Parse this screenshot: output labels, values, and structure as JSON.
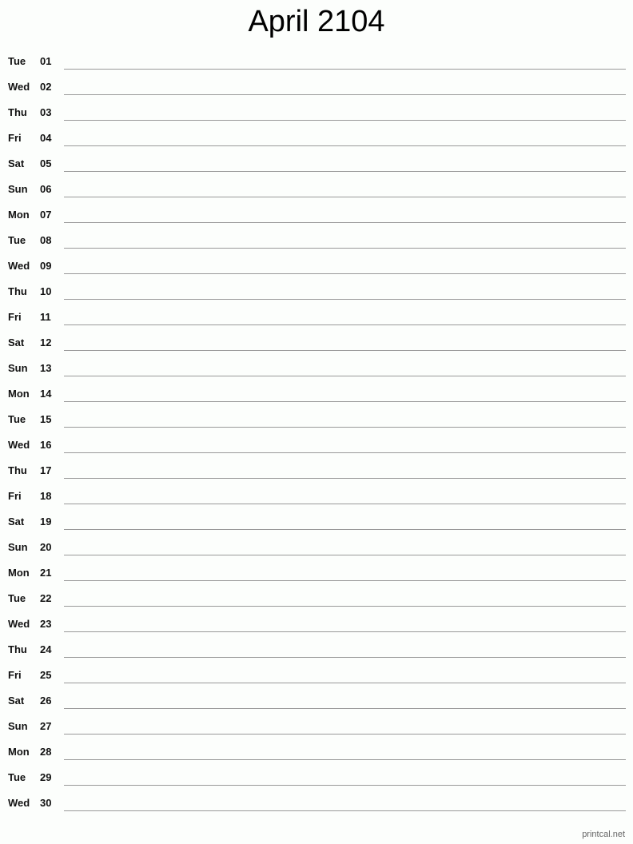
{
  "title": "April 2104",
  "days": [
    {
      "dow": "Tue",
      "day": "01"
    },
    {
      "dow": "Wed",
      "day": "02"
    },
    {
      "dow": "Thu",
      "day": "03"
    },
    {
      "dow": "Fri",
      "day": "04"
    },
    {
      "dow": "Sat",
      "day": "05"
    },
    {
      "dow": "Sun",
      "day": "06"
    },
    {
      "dow": "Mon",
      "day": "07"
    },
    {
      "dow": "Tue",
      "day": "08"
    },
    {
      "dow": "Wed",
      "day": "09"
    },
    {
      "dow": "Thu",
      "day": "10"
    },
    {
      "dow": "Fri",
      "day": "11"
    },
    {
      "dow": "Sat",
      "day": "12"
    },
    {
      "dow": "Sun",
      "day": "13"
    },
    {
      "dow": "Mon",
      "day": "14"
    },
    {
      "dow": "Tue",
      "day": "15"
    },
    {
      "dow": "Wed",
      "day": "16"
    },
    {
      "dow": "Thu",
      "day": "17"
    },
    {
      "dow": "Fri",
      "day": "18"
    },
    {
      "dow": "Sat",
      "day": "19"
    },
    {
      "dow": "Sun",
      "day": "20"
    },
    {
      "dow": "Mon",
      "day": "21"
    },
    {
      "dow": "Tue",
      "day": "22"
    },
    {
      "dow": "Wed",
      "day": "23"
    },
    {
      "dow": "Thu",
      "day": "24"
    },
    {
      "dow": "Fri",
      "day": "25"
    },
    {
      "dow": "Sat",
      "day": "26"
    },
    {
      "dow": "Sun",
      "day": "27"
    },
    {
      "dow": "Mon",
      "day": "28"
    },
    {
      "dow": "Tue",
      "day": "29"
    },
    {
      "dow": "Wed",
      "day": "30"
    }
  ],
  "footer": "printcal.net"
}
